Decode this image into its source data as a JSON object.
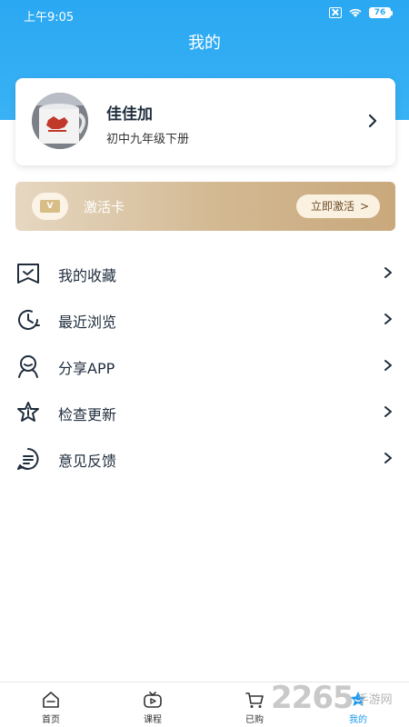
{
  "status_bar": {
    "time": "上午9:05",
    "battery": "76"
  },
  "header": {
    "title": "我的"
  },
  "profile": {
    "name": "佳佳加",
    "grade": "初中九年级下册"
  },
  "activation": {
    "icon_text": "V",
    "label": "激活卡",
    "button_label": "立即激活",
    "button_chevron": ">"
  },
  "menu": [
    {
      "label": "我的收藏",
      "icon": "favorites-icon"
    },
    {
      "label": "最近浏览",
      "icon": "history-icon"
    },
    {
      "label": "分享APP",
      "icon": "share-icon"
    },
    {
      "label": "检查更新",
      "icon": "update-icon"
    },
    {
      "label": "意见反馈",
      "icon": "feedback-icon"
    }
  ],
  "tabbar": [
    {
      "label": "首页",
      "icon": "home-icon"
    },
    {
      "label": "课程",
      "icon": "course-icon"
    },
    {
      "label": "已购",
      "icon": "cart-icon"
    },
    {
      "label": "我的",
      "icon": "profile-icon",
      "active": true
    }
  ],
  "watermark": {
    "digits": "2265",
    "text": "手游网"
  },
  "colors": {
    "header": "#2aa8f2",
    "active_tab": "#1c9bef",
    "text": "#1f2d3d",
    "activation_gold": "#d2b891"
  }
}
